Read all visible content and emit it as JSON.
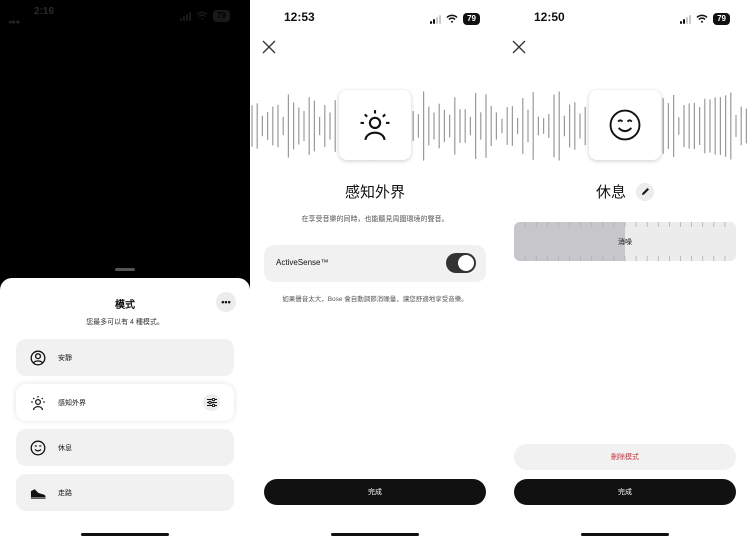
{
  "panel1": {
    "status": {
      "time": "2:16",
      "left_glyph": "◂●●",
      "battery": "79"
    },
    "sheet": {
      "title": "模式",
      "subtitle": "您最多可以有 4 種模式。",
      "more_label": "•••",
      "modes": [
        {
          "label": "安靜",
          "icon": "quiet-icon",
          "active": false
        },
        {
          "label": "感知外界",
          "icon": "aware-icon",
          "active": true
        },
        {
          "label": "休息",
          "icon": "smile-icon",
          "active": false
        },
        {
          "label": "走路",
          "icon": "shoe-icon",
          "active": false
        }
      ]
    }
  },
  "panel2": {
    "status": {
      "time": "12:53",
      "battery": "79"
    },
    "icon": "aware-icon",
    "mode_name": "感知外界",
    "description": "在享受音樂的同時，也能聽見周圍環境的聲音。",
    "toggle": {
      "label": "ActiveSense™",
      "on": true
    },
    "note": "如果聲音太大，Bose 會自動調節消噪量，讓您舒適地享受音樂。",
    "done_label": "完成"
  },
  "panel3": {
    "status": {
      "time": "12:50",
      "battery": "79"
    },
    "icon": "smile-icon",
    "mode_name": "休息",
    "slider": {
      "label": "消噪",
      "level_fraction": 0.5
    },
    "delete_label": "刪除模式",
    "done_label": "完成"
  },
  "colors": {
    "accent_dark": "#111111",
    "danger": "#c8323c",
    "row_bg": "#f1f1f1"
  }
}
